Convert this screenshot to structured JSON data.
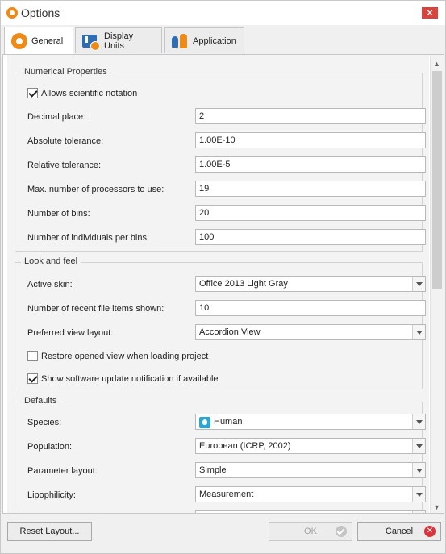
{
  "window": {
    "title": "Options",
    "close_glyph": "✕"
  },
  "tabs": [
    {
      "label": "General",
      "icon": "gear-icon",
      "active": true
    },
    {
      "label": "Display Units",
      "icon": "display-units-icon",
      "active": false
    },
    {
      "label": "Application",
      "icon": "application-icon",
      "active": false
    }
  ],
  "numerical": {
    "title": "Numerical Properties",
    "scientific_notation": {
      "label": "Allows scientific notation",
      "checked": true
    },
    "decimal_place": {
      "label": "Decimal place:",
      "value": "2"
    },
    "absolute_tolerance": {
      "label": "Absolute tolerance:",
      "value": "1.00E-10"
    },
    "relative_tolerance": {
      "label": "Relative tolerance:",
      "value": "1.00E-5"
    },
    "max_processors": {
      "label": "Max. number of processors to use:",
      "value": "19"
    },
    "number_of_bins": {
      "label": "Number of bins:",
      "value": "20"
    },
    "individuals_per_bin": {
      "label": "Number of individuals per bins:",
      "value": "100"
    }
  },
  "look": {
    "title": "Look and feel",
    "active_skin": {
      "label": "Active skin:",
      "value": "Office 2013 Light Gray"
    },
    "recent_items": {
      "label": "Number of recent file items shown:",
      "value": "10"
    },
    "view_layout": {
      "label": "Preferred view layout:",
      "value": "Accordion View"
    },
    "restore_view": {
      "label": "Restore opened view when loading project",
      "checked": false
    },
    "update_notification": {
      "label": "Show software update notification if available",
      "checked": true
    }
  },
  "defaults": {
    "title": "Defaults",
    "species": {
      "label": "Species:",
      "value": "Human",
      "icon": "human-icon"
    },
    "population": {
      "label": "Population:",
      "value": "European (ICRP, 2002)"
    },
    "parameter_layout": {
      "label": "Parameter layout:",
      "value": "Simple"
    },
    "lipophilicity": {
      "label": "Lipophilicity:",
      "value": "Measurement"
    }
  },
  "footer": {
    "reset_label": "Reset Layout...",
    "ok_label": "OK",
    "cancel_label": "Cancel"
  },
  "colors": {
    "accent_orange": "#f08a16",
    "accent_blue": "#2c6db5",
    "cancel_red": "#d9333b"
  }
}
